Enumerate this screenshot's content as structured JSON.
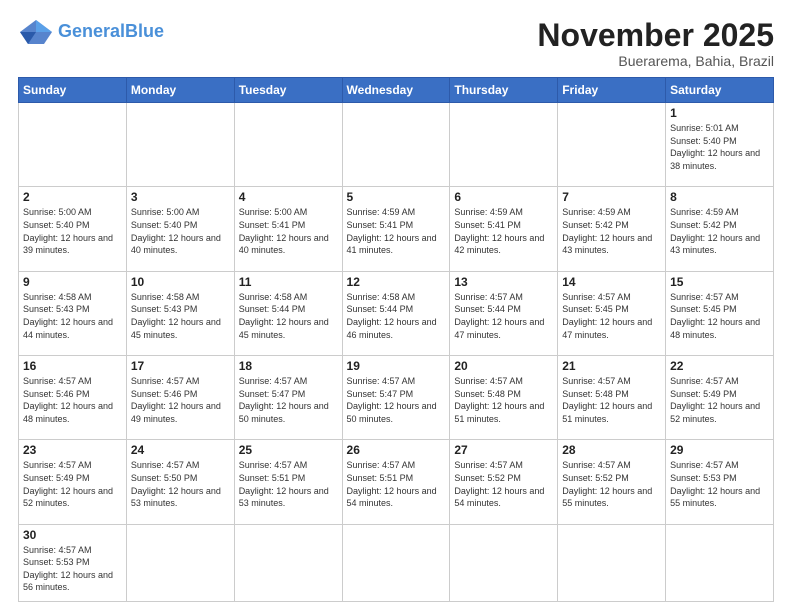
{
  "header": {
    "logo_general": "General",
    "logo_blue": "Blue",
    "title": "November 2025",
    "subtitle": "Buerarema, Bahia, Brazil"
  },
  "days_of_week": [
    "Sunday",
    "Monday",
    "Tuesday",
    "Wednesday",
    "Thursday",
    "Friday",
    "Saturday"
  ],
  "weeks": [
    [
      {
        "day": "",
        "info": ""
      },
      {
        "day": "",
        "info": ""
      },
      {
        "day": "",
        "info": ""
      },
      {
        "day": "",
        "info": ""
      },
      {
        "day": "",
        "info": ""
      },
      {
        "day": "",
        "info": ""
      },
      {
        "day": "1",
        "info": "Sunrise: 5:01 AM\nSunset: 5:40 PM\nDaylight: 12 hours and 38 minutes."
      }
    ],
    [
      {
        "day": "2",
        "info": "Sunrise: 5:00 AM\nSunset: 5:40 PM\nDaylight: 12 hours and 39 minutes."
      },
      {
        "day": "3",
        "info": "Sunrise: 5:00 AM\nSunset: 5:40 PM\nDaylight: 12 hours and 40 minutes."
      },
      {
        "day": "4",
        "info": "Sunrise: 5:00 AM\nSunset: 5:41 PM\nDaylight: 12 hours and 40 minutes."
      },
      {
        "day": "5",
        "info": "Sunrise: 4:59 AM\nSunset: 5:41 PM\nDaylight: 12 hours and 41 minutes."
      },
      {
        "day": "6",
        "info": "Sunrise: 4:59 AM\nSunset: 5:41 PM\nDaylight: 12 hours and 42 minutes."
      },
      {
        "day": "7",
        "info": "Sunrise: 4:59 AM\nSunset: 5:42 PM\nDaylight: 12 hours and 43 minutes."
      },
      {
        "day": "8",
        "info": "Sunrise: 4:59 AM\nSunset: 5:42 PM\nDaylight: 12 hours and 43 minutes."
      }
    ],
    [
      {
        "day": "9",
        "info": "Sunrise: 4:58 AM\nSunset: 5:43 PM\nDaylight: 12 hours and 44 minutes."
      },
      {
        "day": "10",
        "info": "Sunrise: 4:58 AM\nSunset: 5:43 PM\nDaylight: 12 hours and 45 minutes."
      },
      {
        "day": "11",
        "info": "Sunrise: 4:58 AM\nSunset: 5:44 PM\nDaylight: 12 hours and 45 minutes."
      },
      {
        "day": "12",
        "info": "Sunrise: 4:58 AM\nSunset: 5:44 PM\nDaylight: 12 hours and 46 minutes."
      },
      {
        "day": "13",
        "info": "Sunrise: 4:57 AM\nSunset: 5:44 PM\nDaylight: 12 hours and 47 minutes."
      },
      {
        "day": "14",
        "info": "Sunrise: 4:57 AM\nSunset: 5:45 PM\nDaylight: 12 hours and 47 minutes."
      },
      {
        "day": "15",
        "info": "Sunrise: 4:57 AM\nSunset: 5:45 PM\nDaylight: 12 hours and 48 minutes."
      }
    ],
    [
      {
        "day": "16",
        "info": "Sunrise: 4:57 AM\nSunset: 5:46 PM\nDaylight: 12 hours and 48 minutes."
      },
      {
        "day": "17",
        "info": "Sunrise: 4:57 AM\nSunset: 5:46 PM\nDaylight: 12 hours and 49 minutes."
      },
      {
        "day": "18",
        "info": "Sunrise: 4:57 AM\nSunset: 5:47 PM\nDaylight: 12 hours and 50 minutes."
      },
      {
        "day": "19",
        "info": "Sunrise: 4:57 AM\nSunset: 5:47 PM\nDaylight: 12 hours and 50 minutes."
      },
      {
        "day": "20",
        "info": "Sunrise: 4:57 AM\nSunset: 5:48 PM\nDaylight: 12 hours and 51 minutes."
      },
      {
        "day": "21",
        "info": "Sunrise: 4:57 AM\nSunset: 5:48 PM\nDaylight: 12 hours and 51 minutes."
      },
      {
        "day": "22",
        "info": "Sunrise: 4:57 AM\nSunset: 5:49 PM\nDaylight: 12 hours and 52 minutes."
      }
    ],
    [
      {
        "day": "23",
        "info": "Sunrise: 4:57 AM\nSunset: 5:49 PM\nDaylight: 12 hours and 52 minutes."
      },
      {
        "day": "24",
        "info": "Sunrise: 4:57 AM\nSunset: 5:50 PM\nDaylight: 12 hours and 53 minutes."
      },
      {
        "day": "25",
        "info": "Sunrise: 4:57 AM\nSunset: 5:51 PM\nDaylight: 12 hours and 53 minutes."
      },
      {
        "day": "26",
        "info": "Sunrise: 4:57 AM\nSunset: 5:51 PM\nDaylight: 12 hours and 54 minutes."
      },
      {
        "day": "27",
        "info": "Sunrise: 4:57 AM\nSunset: 5:52 PM\nDaylight: 12 hours and 54 minutes."
      },
      {
        "day": "28",
        "info": "Sunrise: 4:57 AM\nSunset: 5:52 PM\nDaylight: 12 hours and 55 minutes."
      },
      {
        "day": "29",
        "info": "Sunrise: 4:57 AM\nSunset: 5:53 PM\nDaylight: 12 hours and 55 minutes."
      }
    ],
    [
      {
        "day": "30",
        "info": "Sunrise: 4:57 AM\nSunset: 5:53 PM\nDaylight: 12 hours and 56 minutes."
      },
      {
        "day": "",
        "info": ""
      },
      {
        "day": "",
        "info": ""
      },
      {
        "day": "",
        "info": ""
      },
      {
        "day": "",
        "info": ""
      },
      {
        "day": "",
        "info": ""
      },
      {
        "day": "",
        "info": ""
      }
    ]
  ],
  "colors": {
    "header_bg": "#3a6fc4",
    "header_text": "#ffffff",
    "accent_blue": "#4a90d9"
  }
}
